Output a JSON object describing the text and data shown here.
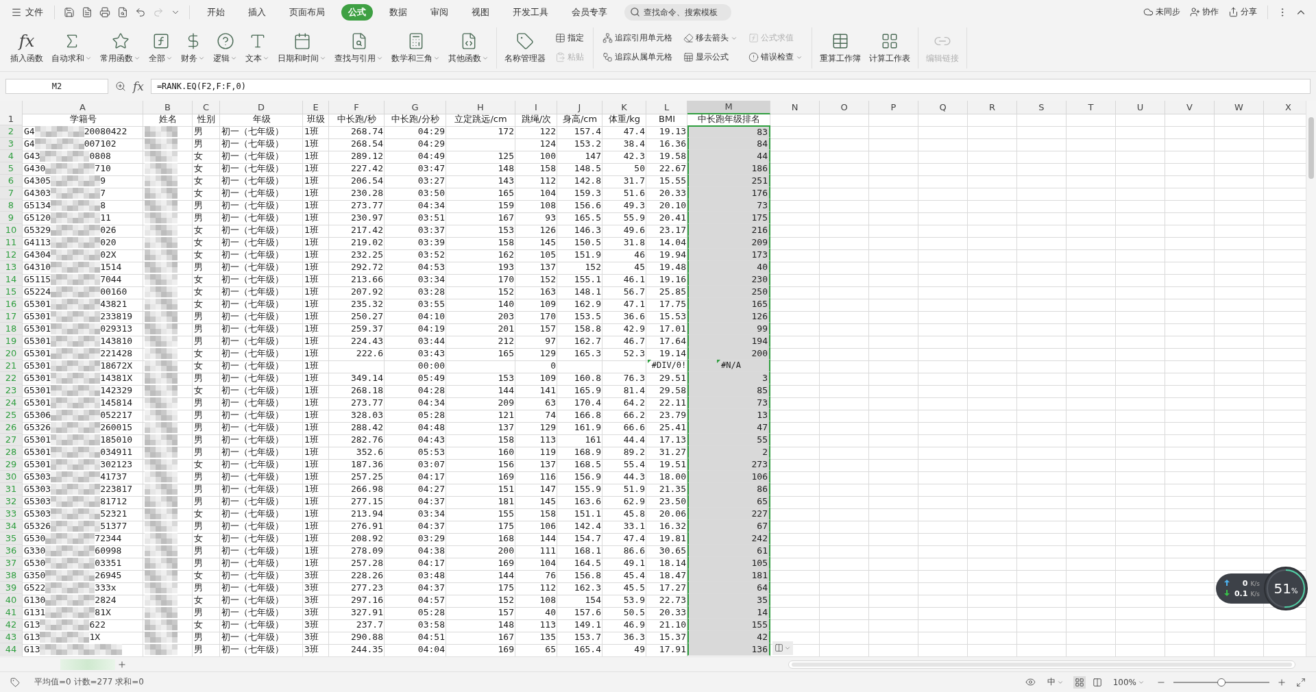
{
  "menu": {
    "file": "文件",
    "tabs": [
      {
        "label": "开始",
        "selected": false
      },
      {
        "label": "插入",
        "selected": false
      },
      {
        "label": "页面布局",
        "selected": false
      },
      {
        "label": "公式",
        "selected": true
      },
      {
        "label": "数据",
        "selected": false
      },
      {
        "label": "审阅",
        "selected": false
      },
      {
        "label": "视图",
        "selected": false
      },
      {
        "label": "开发工具",
        "selected": false
      },
      {
        "label": "会员专享",
        "selected": false
      }
    ],
    "search": {
      "placeholder": "查找命令、搜索模板"
    },
    "actions": [
      "未同步",
      "协作",
      "分享"
    ]
  },
  "ribbon": {
    "groups": [
      {
        "items": [
          {
            "kind": "large",
            "glyph": "fx",
            "label": "插入函数",
            "dropdown": false,
            "disabled": false
          },
          {
            "kind": "large",
            "label": "自动求和",
            "dropdown": true,
            "disabled": false
          },
          {
            "kind": "large",
            "label": "常用函数",
            "dropdown": true,
            "disabled": false
          },
          {
            "kind": "large",
            "label": "全部",
            "dropdown": true,
            "disabled": false
          },
          {
            "kind": "large",
            "label": "财务",
            "dropdown": true,
            "disabled": false
          },
          {
            "kind": "large",
            "label": "逻辑",
            "dropdown": true,
            "disabled": false
          },
          {
            "kind": "large",
            "label": "文本",
            "dropdown": true,
            "disabled": false
          },
          {
            "kind": "large",
            "label": "日期和时间",
            "dropdown": true,
            "disabled": false
          },
          {
            "kind": "large",
            "label": "查找与引用",
            "dropdown": true,
            "disabled": false
          },
          {
            "kind": "large",
            "label": "数学和三角",
            "dropdown": true,
            "disabled": false
          },
          {
            "kind": "large",
            "label": "其他函数",
            "dropdown": true,
            "disabled": false
          }
        ]
      },
      {
        "items": [
          {
            "kind": "large",
            "label": "名称管理器",
            "dropdown": false,
            "disabled": false
          },
          {
            "kind": "stack",
            "items": [
              {
                "label": "指定",
                "dropdown": false,
                "disabled": false
              },
              {
                "label": "粘贴",
                "dropdown": false,
                "disabled": true
              }
            ]
          }
        ]
      },
      {
        "items": [
          {
            "kind": "stack",
            "items": [
              {
                "label": "追踪引用单元格",
                "dropdown": false,
                "disabled": false
              },
              {
                "label": "追踪从属单元格",
                "dropdown": false,
                "disabled": false
              }
            ]
          },
          {
            "kind": "stack",
            "items": [
              {
                "label": "移去箭头",
                "dropdown": true,
                "disabled": false
              },
              {
                "label": "显示公式",
                "dropdown": false,
                "disabled": false
              }
            ]
          },
          {
            "kind": "stack",
            "items": [
              {
                "label": "公式求值",
                "dropdown": false,
                "disabled": true
              },
              {
                "label": "错误检查",
                "dropdown": true,
                "disabled": false
              }
            ]
          }
        ]
      },
      {
        "items": [
          {
            "kind": "large",
            "label": "重算工作簿",
            "dropdown": false,
            "disabled": false
          },
          {
            "kind": "large",
            "label": "计算工作表",
            "dropdown": false,
            "disabled": false
          }
        ]
      },
      {
        "items": [
          {
            "kind": "large",
            "label": "编辑链接",
            "dropdown": false,
            "disabled": true
          }
        ]
      }
    ]
  },
  "formula_bar": {
    "name_box": "M2",
    "fx": "fx",
    "formula": "=RANK.EQ(F2,F:F,0)"
  },
  "sheet": {
    "columns": [
      {
        "letter": "A",
        "selected": false
      },
      {
        "letter": "B",
        "selected": false
      },
      {
        "letter": "C",
        "selected": false
      },
      {
        "letter": "D",
        "selected": false
      },
      {
        "letter": "E",
        "selected": false
      },
      {
        "letter": "F",
        "selected": false
      },
      {
        "letter": "G",
        "selected": false
      },
      {
        "letter": "H",
        "selected": false
      },
      {
        "letter": "I",
        "selected": false
      },
      {
        "letter": "J",
        "selected": false
      },
      {
        "letter": "K",
        "selected": false
      },
      {
        "letter": "L",
        "selected": false
      },
      {
        "letter": "M",
        "selected": true
      },
      {
        "letter": "N",
        "selected": false
      },
      {
        "letter": "O",
        "selected": false
      },
      {
        "letter": "P",
        "selected": false
      },
      {
        "letter": "Q",
        "selected": false
      },
      {
        "letter": "R",
        "selected": false
      },
      {
        "letter": "S",
        "selected": false
      },
      {
        "letter": "T",
        "selected": false
      },
      {
        "letter": "U",
        "selected": false
      },
      {
        "letter": "V",
        "selected": false
      },
      {
        "letter": "W",
        "selected": false
      },
      {
        "letter": "X",
        "selected": false
      }
    ],
    "header_row": {
      "n": "1",
      "selected": false,
      "cells": [
        "学籍号",
        "姓名",
        "性别",
        "年级",
        "班级",
        "中长跑/秒",
        "中长跑/分秒",
        "立定跳远/cm",
        "跳绳/次",
        "身高/cm",
        "体重/kg",
        "BMI",
        "中长跑年级排名"
      ]
    },
    "rows": [
      {
        "n": "2",
        "selected": true,
        "cells": [
          {
            "kind": "masked",
            "parts": [
              "G4",
              "20080422"
            ]
          },
          {
            "kind": "masked"
          },
          "男",
          "初一（七年级）",
          "1班",
          "268.74",
          "04:29",
          "172",
          "122",
          "157.4",
          "47.4",
          "19.13",
          "83"
        ]
      },
      {
        "n": "3",
        "selected": true,
        "cells": [
          {
            "kind": "masked",
            "parts": [
              "G4",
              "007102"
            ]
          },
          {
            "kind": "masked"
          },
          "男",
          "初一（七年级）",
          "1班",
          "268.54",
          "04:29",
          null,
          "124",
          "153.2",
          "38.4",
          "16.36",
          "84"
        ]
      },
      {
        "n": "4",
        "selected": true,
        "cells": [
          {
            "kind": "masked",
            "parts": [
              "G43",
              "0808"
            ]
          },
          {
            "kind": "masked"
          },
          "女",
          "初一（七年级）",
          "1班",
          "289.12",
          "04:49",
          "125",
          "100",
          "147",
          "42.3",
          "19.58",
          "44"
        ]
      },
      {
        "n": "5",
        "selected": true,
        "cells": [
          {
            "kind": "masked",
            "parts": [
              "G430",
              "710"
            ]
          },
          {
            "kind": "masked"
          },
          "女",
          "初一（七年级）",
          "1班",
          "227.42",
          "03:47",
          "148",
          "158",
          "148.5",
          "50",
          "22.67",
          "186"
        ]
      },
      {
        "n": "6",
        "selected": true,
        "cells": [
          {
            "kind": "masked",
            "parts": [
              "G4305",
              "9"
            ]
          },
          {
            "kind": "masked"
          },
          "女",
          "初一（七年级）",
          "1班",
          "206.54",
          "03:27",
          "143",
          "112",
          "142.8",
          "31.7",
          "15.55",
          "251"
        ]
      },
      {
        "n": "7",
        "selected": true,
        "cells": [
          {
            "kind": "masked",
            "parts": [
              "G4303",
              "7"
            ]
          },
          {
            "kind": "masked"
          },
          "女",
          "初一（七年级）",
          "1班",
          "230.28",
          "03:50",
          "165",
          "104",
          "159.3",
          "51.6",
          "20.33",
          "176"
        ]
      },
      {
        "n": "8",
        "selected": true,
        "cells": [
          {
            "kind": "masked",
            "parts": [
              "G5134",
              "8"
            ]
          },
          {
            "kind": "masked"
          },
          "男",
          "初一（七年级）",
          "1班",
          "273.77",
          "04:34",
          "159",
          "108",
          "156.6",
          "49.3",
          "20.10",
          "73"
        ]
      },
      {
        "n": "9",
        "selected": true,
        "cells": [
          {
            "kind": "masked",
            "parts": [
              "G5120",
              "11"
            ]
          },
          {
            "kind": "masked"
          },
          "男",
          "初一（七年级）",
          "1班",
          "230.97",
          "03:51",
          "167",
          "93",
          "165.5",
          "55.9",
          "20.41",
          "175"
        ]
      },
      {
        "n": "10",
        "selected": true,
        "cells": [
          {
            "kind": "masked",
            "parts": [
              "G5329",
              "026"
            ]
          },
          {
            "kind": "masked"
          },
          "女",
          "初一（七年级）",
          "1班",
          "217.42",
          "03:37",
          "153",
          "126",
          "146.3",
          "49.6",
          "23.17",
          "216"
        ]
      },
      {
        "n": "11",
        "selected": true,
        "cells": [
          {
            "kind": "masked",
            "parts": [
              "G4113",
              "020"
            ]
          },
          {
            "kind": "masked"
          },
          "女",
          "初一（七年级）",
          "1班",
          "219.02",
          "03:39",
          "158",
          "145",
          "150.5",
          "31.8",
          "14.04",
          "209"
        ]
      },
      {
        "n": "12",
        "selected": true,
        "cells": [
          {
            "kind": "masked",
            "parts": [
              "G4304",
              "02X"
            ]
          },
          {
            "kind": "masked"
          },
          "女",
          "初一（七年级）",
          "1班",
          "232.25",
          "03:52",
          "162",
          "105",
          "151.9",
          "46",
          "19.94",
          "173"
        ]
      },
      {
        "n": "13",
        "selected": true,
        "cells": [
          {
            "kind": "masked",
            "parts": [
              "G4310",
              "1514"
            ]
          },
          {
            "kind": "masked"
          },
          "男",
          "初一（七年级）",
          "1班",
          "292.72",
          "04:53",
          "193",
          "137",
          "152",
          "45",
          "19.48",
          "40"
        ]
      },
      {
        "n": "14",
        "selected": true,
        "cells": [
          {
            "kind": "masked",
            "parts": [
              "G5115",
              "7044"
            ]
          },
          {
            "kind": "masked"
          },
          "女",
          "初一（七年级）",
          "1班",
          "213.66",
          "03:34",
          "170",
          "152",
          "155.1",
          "46.1",
          "19.16",
          "230"
        ]
      },
      {
        "n": "15",
        "selected": true,
        "cells": [
          {
            "kind": "masked",
            "parts": [
              "G5224",
              "00160"
            ]
          },
          {
            "kind": "masked"
          },
          "女",
          "初一（七年级）",
          "1班",
          "207.92",
          "03:28",
          "152",
          "163",
          "148.1",
          "56.7",
          "25.85",
          "250"
        ]
      },
      {
        "n": "16",
        "selected": true,
        "cells": [
          {
            "kind": "masked",
            "parts": [
              "G5301",
              "43821"
            ]
          },
          {
            "kind": "masked"
          },
          "女",
          "初一（七年级）",
          "1班",
          "235.32",
          "03:55",
          "140",
          "109",
          "162.9",
          "47.1",
          "17.75",
          "165"
        ]
      },
      {
        "n": "17",
        "selected": true,
        "cells": [
          {
            "kind": "masked",
            "parts": [
              "G5301",
              "233819"
            ]
          },
          {
            "kind": "masked"
          },
          "男",
          "初一（七年级）",
          "1班",
          "250.27",
          "04:10",
          "203",
          "170",
          "153.5",
          "36.6",
          "15.53",
          "126"
        ]
      },
      {
        "n": "18",
        "selected": true,
        "cells": [
          {
            "kind": "masked",
            "parts": [
              "G5301",
              "029313"
            ]
          },
          {
            "kind": "masked"
          },
          "男",
          "初一（七年级）",
          "1班",
          "259.37",
          "04:19",
          "201",
          "157",
          "158.8",
          "42.9",
          "17.01",
          "99"
        ]
      },
      {
        "n": "19",
        "selected": true,
        "cells": [
          {
            "kind": "masked",
            "parts": [
              "G5301",
              "143810"
            ]
          },
          {
            "kind": "masked"
          },
          "男",
          "初一（七年级）",
          "1班",
          "224.43",
          "03:44",
          "212",
          "97",
          "162.7",
          "46.7",
          "17.64",
          "194"
        ]
      },
      {
        "n": "20",
        "selected": true,
        "cells": [
          {
            "kind": "masked",
            "parts": [
              "G5301",
              "221428"
            ]
          },
          {
            "kind": "masked"
          },
          "女",
          "初一（七年级）",
          "1班",
          "222.6",
          "03:43",
          "165",
          "129",
          "165.3",
          "52.3",
          "19.14",
          "200"
        ]
      },
      {
        "n": "21",
        "selected": true,
        "cells": [
          {
            "kind": "masked",
            "parts": [
              "G5301",
              "18672X"
            ]
          },
          {
            "kind": "masked"
          },
          "女",
          "初一（七年级）",
          "1班",
          null,
          "00:00",
          null,
          "0",
          null,
          null,
          {
            "kind": "error",
            "text": "#DIV/0!"
          },
          {
            "kind": "error",
            "text": "#N/A"
          }
        ]
      },
      {
        "n": "22",
        "selected": true,
        "cells": [
          {
            "kind": "masked",
            "parts": [
              "G5301",
              "14381X"
            ]
          },
          {
            "kind": "masked"
          },
          "男",
          "初一（七年级）",
          "1班",
          "349.14",
          "05:49",
          "153",
          "109",
          "160.8",
          "76.3",
          "29.51",
          "3"
        ]
      },
      {
        "n": "23",
        "selected": true,
        "cells": [
          {
            "kind": "masked",
            "parts": [
              "G5301",
              "142329"
            ]
          },
          {
            "kind": "masked"
          },
          "女",
          "初一（七年级）",
          "1班",
          "268.18",
          "04:28",
          "144",
          "141",
          "165.9",
          "81.4",
          "29.58",
          "85"
        ]
      },
      {
        "n": "24",
        "selected": true,
        "cells": [
          {
            "kind": "masked",
            "parts": [
              "G5301",
              "145814"
            ]
          },
          {
            "kind": "masked"
          },
          "男",
          "初一（七年级）",
          "1班",
          "273.77",
          "04:34",
          "209",
          "63",
          "170.4",
          "64.2",
          "22.11",
          "73"
        ]
      },
      {
        "n": "25",
        "selected": true,
        "cells": [
          {
            "kind": "masked",
            "parts": [
              "G5306",
              "052217"
            ]
          },
          {
            "kind": "masked"
          },
          "男",
          "初一（七年级）",
          "1班",
          "328.03",
          "05:28",
          "121",
          "74",
          "166.8",
          "66.2",
          "23.79",
          "13"
        ]
      },
      {
        "n": "26",
        "selected": true,
        "cells": [
          {
            "kind": "masked",
            "parts": [
              "G5326",
              "260015"
            ]
          },
          {
            "kind": "masked"
          },
          "男",
          "初一（七年级）",
          "1班",
          "288.42",
          "04:48",
          "137",
          "129",
          "161.9",
          "66.6",
          "25.41",
          "47"
        ]
      },
      {
        "n": "27",
        "selected": true,
        "cells": [
          {
            "kind": "masked",
            "parts": [
              "G5301",
              "185010"
            ]
          },
          {
            "kind": "masked"
          },
          "男",
          "初一（七年级）",
          "1班",
          "282.76",
          "04:43",
          "158",
          "113",
          "161",
          "44.4",
          "17.13",
          "55"
        ]
      },
      {
        "n": "28",
        "selected": true,
        "cells": [
          {
            "kind": "masked",
            "parts": [
              "G5301",
              "034911"
            ]
          },
          {
            "kind": "masked"
          },
          "男",
          "初一（七年级）",
          "1班",
          "352.6",
          "05:53",
          "160",
          "119",
          "168.9",
          "89.2",
          "31.27",
          "2"
        ]
      },
      {
        "n": "29",
        "selected": true,
        "cells": [
          {
            "kind": "masked",
            "parts": [
              "G5301",
              "302123"
            ]
          },
          {
            "kind": "masked"
          },
          "女",
          "初一（七年级）",
          "1班",
          "187.36",
          "03:07",
          "156",
          "137",
          "168.5",
          "55.4",
          "19.51",
          "273"
        ]
      },
      {
        "n": "30",
        "selected": true,
        "cells": [
          {
            "kind": "masked",
            "parts": [
              "G5303",
              "41737"
            ]
          },
          {
            "kind": "masked"
          },
          "男",
          "初一（七年级）",
          "1班",
          "257.25",
          "04:17",
          "169",
          "116",
          "156.9",
          "44.3",
          "18.00",
          "106"
        ]
      },
      {
        "n": "31",
        "selected": true,
        "cells": [
          {
            "kind": "masked",
            "parts": [
              "G5303",
              "223817"
            ]
          },
          {
            "kind": "masked"
          },
          "男",
          "初一（七年级）",
          "1班",
          "266.98",
          "04:27",
          "151",
          "147",
          "155.9",
          "51.9",
          "21.35",
          "86"
        ]
      },
      {
        "n": "32",
        "selected": true,
        "cells": [
          {
            "kind": "masked",
            "parts": [
              "G5303",
              "81712"
            ]
          },
          {
            "kind": "masked"
          },
          "男",
          "初一（七年级）",
          "1班",
          "277.15",
          "04:37",
          "181",
          "145",
          "163.6",
          "62.9",
          "23.50",
          "65"
        ]
      },
      {
        "n": "33",
        "selected": true,
        "cells": [
          {
            "kind": "masked",
            "parts": [
              "G5303",
              "52321"
            ]
          },
          {
            "kind": "masked"
          },
          "女",
          "初一（七年级）",
          "1班",
          "213.94",
          "03:34",
          "155",
          "158",
          "151.1",
          "45.8",
          "20.06",
          "227"
        ]
      },
      {
        "n": "34",
        "selected": true,
        "cells": [
          {
            "kind": "masked",
            "parts": [
              "G5326",
              "51377"
            ]
          },
          {
            "kind": "masked"
          },
          "男",
          "初一（七年级）",
          "1班",
          "276.91",
          "04:37",
          "175",
          "106",
          "142.4",
          "33.1",
          "16.32",
          "67"
        ]
      },
      {
        "n": "35",
        "selected": true,
        "cells": [
          {
            "kind": "masked",
            "parts": [
              "G530",
              "72344"
            ]
          },
          {
            "kind": "masked"
          },
          "女",
          "初一（七年级）",
          "1班",
          "208.92",
          "03:29",
          "168",
          "144",
          "154.7",
          "47.4",
          "19.81",
          "242"
        ]
      },
      {
        "n": "36",
        "selected": true,
        "cells": [
          {
            "kind": "masked",
            "parts": [
              "G330",
              "60998"
            ]
          },
          {
            "kind": "masked"
          },
          "男",
          "初一（七年级）",
          "1班",
          "278.09",
          "04:38",
          "200",
          "111",
          "168.1",
          "86.6",
          "30.65",
          "61"
        ]
      },
      {
        "n": "37",
        "selected": true,
        "cells": [
          {
            "kind": "masked",
            "parts": [
              "G530",
              "03351"
            ]
          },
          {
            "kind": "masked"
          },
          "男",
          "初一（七年级）",
          "1班",
          "257.28",
          "04:17",
          "169",
          "104",
          "164.5",
          "49.1",
          "18.14",
          "105"
        ]
      },
      {
        "n": "38",
        "selected": true,
        "cells": [
          {
            "kind": "masked",
            "parts": [
              "G350",
              "26945"
            ]
          },
          {
            "kind": "masked"
          },
          "女",
          "初一（七年级）",
          "3班",
          "228.26",
          "03:48",
          "144",
          "76",
          "156.8",
          "45.4",
          "18.47",
          "181"
        ]
      },
      {
        "n": "39",
        "selected": true,
        "cells": [
          {
            "kind": "masked",
            "parts": [
              "G522",
              "333x"
            ]
          },
          {
            "kind": "masked"
          },
          "男",
          "初一（七年级）",
          "3班",
          "277.23",
          "04:37",
          "175",
          "112",
          "162.3",
          "45.5",
          "17.27",
          "64"
        ]
      },
      {
        "n": "40",
        "selected": true,
        "cells": [
          {
            "kind": "masked",
            "parts": [
              "G130",
              "2824"
            ]
          },
          {
            "kind": "masked"
          },
          "女",
          "初一（七年级）",
          "3班",
          "297.16",
          "04:57",
          "152",
          "108",
          "154",
          "53.9",
          "22.73",
          "35"
        ]
      },
      {
        "n": "41",
        "selected": true,
        "cells": [
          {
            "kind": "masked",
            "parts": [
              "G131",
              "81X"
            ]
          },
          {
            "kind": "masked"
          },
          "男",
          "初一（七年级）",
          "3班",
          "327.91",
          "05:28",
          "157",
          "40",
          "157.6",
          "50.5",
          "20.33",
          "14"
        ]
      },
      {
        "n": "42",
        "selected": true,
        "cells": [
          {
            "kind": "masked",
            "parts": [
              "G13",
              "622"
            ]
          },
          {
            "kind": "masked"
          },
          "女",
          "初一（七年级）",
          "3班",
          "237.7",
          "03:58",
          "148",
          "113",
          "149.1",
          "46.9",
          "21.10",
          "155"
        ]
      },
      {
        "n": "43",
        "selected": true,
        "cells": [
          {
            "kind": "masked",
            "parts": [
              "G13",
              "1X"
            ]
          },
          {
            "kind": "masked"
          },
          "男",
          "初一（七年级）",
          "3班",
          "290.88",
          "04:51",
          "167",
          "135",
          "153.7",
          "36.3",
          "15.37",
          "42"
        ]
      },
      {
        "n": "44",
        "selected": true,
        "cells": [
          {
            "kind": "masked",
            "parts": [
              "G13"
            ]
          },
          {
            "kind": "masked"
          },
          "男",
          "初一（七年级）",
          "3班",
          "244.35",
          "04:04",
          "169",
          "65",
          "165.4",
          "49",
          "17.91",
          "136"
        ]
      }
    ]
  },
  "net_meter": {
    "upload": "0",
    "upload_unit": "K/s",
    "download": "0.1",
    "download_unit": "K/s",
    "cpu": "51",
    "cpu_unit": "%",
    "level": 0.51
  },
  "status_bar": {
    "summary": "平均值=0 计数=277 求和=0",
    "input_mode": "中",
    "views": [
      {
        "selected": true
      },
      {
        "selected": false
      }
    ],
    "zoom": "100%",
    "level": 0.5
  }
}
